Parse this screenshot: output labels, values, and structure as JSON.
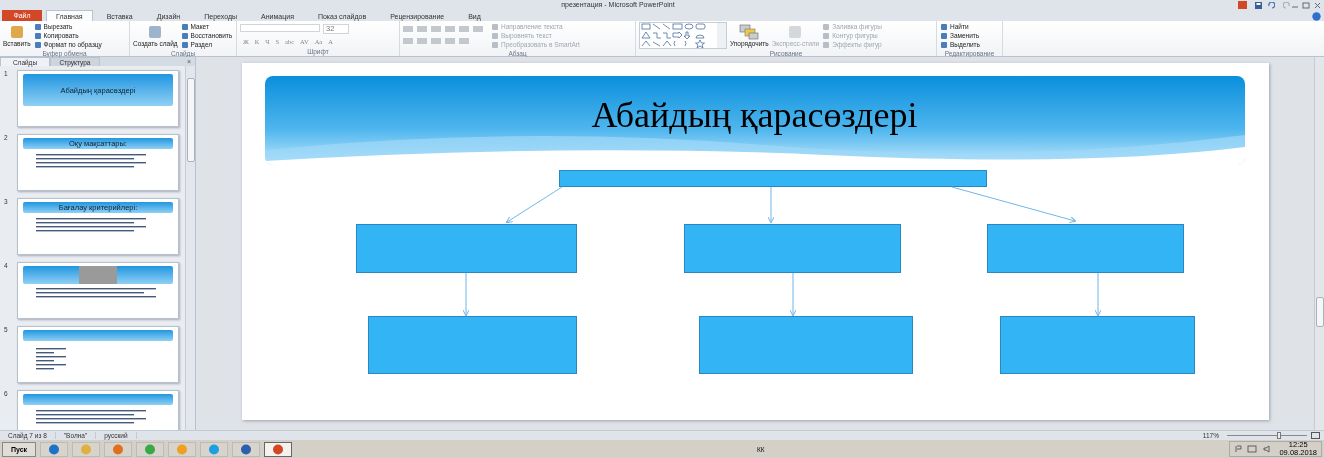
{
  "window": {
    "title": "презентация - Microsoft PowerPoint"
  },
  "file_tab": "Файл",
  "tabs": [
    {
      "label": "Главная",
      "selected": true
    },
    {
      "label": "Вставка",
      "selected": false
    },
    {
      "label": "Дизайн",
      "selected": false
    },
    {
      "label": "Переходы",
      "selected": false
    },
    {
      "label": "Анимация",
      "selected": false
    },
    {
      "label": "Показ слайдов",
      "selected": false
    },
    {
      "label": "Рецензирование",
      "selected": false
    },
    {
      "label": "Вид",
      "selected": false
    }
  ],
  "ribbon": [
    {
      "label": "Буфер обмена",
      "kind": "clipboard",
      "large": {
        "label": "Вставить",
        "disabled": false
      },
      "small": [
        {
          "label": "Вырезать",
          "disabled": false
        },
        {
          "label": "Копировать",
          "disabled": false
        },
        {
          "label": "Формат по образцу",
          "disabled": false
        }
      ]
    },
    {
      "label": "Слайды",
      "kind": "slides",
      "large": {
        "label": "Создать слайд",
        "disabled": false
      },
      "small": [
        {
          "label": "Макет",
          "disabled": false
        },
        {
          "label": "Восстановить",
          "disabled": false
        },
        {
          "label": "Раздел",
          "disabled": false
        }
      ]
    },
    {
      "label": "Шрифт",
      "kind": "font",
      "font_size": "32",
      "format_buttons": [
        "Ж",
        "К",
        "Ч",
        "S",
        "abc",
        "AV",
        "Aa",
        "A"
      ]
    },
    {
      "label": "Абзац",
      "kind": "paragraph",
      "small": [
        {
          "label": "Направление текста",
          "disabled": true
        },
        {
          "label": "Выровнять текст",
          "disabled": true
        },
        {
          "label": "Преобразовать в SmartArt",
          "disabled": true
        }
      ]
    },
    {
      "label": "Рисование",
      "kind": "drawing",
      "large": {
        "label": "Упорядочить",
        "disabled": false
      },
      "large2": {
        "label": "Экспресс-стили",
        "disabled": true
      },
      "small": [
        {
          "label": "Заливка фигуры",
          "disabled": true
        },
        {
          "label": "Контур фигуры",
          "disabled": true
        },
        {
          "label": "Эффекты фигур",
          "disabled": true
        }
      ]
    },
    {
      "label": "Редактирование",
      "kind": "editing",
      "small": [
        {
          "label": "Найти",
          "disabled": false
        },
        {
          "label": "Заменить",
          "disabled": false
        },
        {
          "label": "Выделить",
          "disabled": false
        }
      ]
    }
  ],
  "panel_close": "×",
  "panel_tabs": [
    {
      "label": "Слайды",
      "selected": true
    },
    {
      "label": "Структура",
      "selected": false
    }
  ],
  "slides": [
    {
      "number": "1",
      "kind": "title",
      "title": "Абайдың қарасөздері"
    },
    {
      "number": "2",
      "kind": "bullets",
      "title": "Оқу мақсаттары:"
    },
    {
      "number": "3",
      "kind": "bullets",
      "title": "Бағалау критерийлері:"
    },
    {
      "number": "4",
      "kind": "photo"
    },
    {
      "number": "5",
      "kind": "list"
    },
    {
      "number": "6",
      "kind": "bullets"
    }
  ],
  "slide": {
    "title": "Абайдың қарасөздері"
  },
  "status_bar": {
    "slide": "Слайд 7 из 8",
    "theme": "\"Волна\"",
    "language": "русский",
    "zoom": "117%",
    "zoom_slider": {
      "level": 0.62
    }
  },
  "taskbar": {
    "start": "Пуск",
    "language": "КК",
    "time": "12:25",
    "date": "09.08.2018"
  }
}
